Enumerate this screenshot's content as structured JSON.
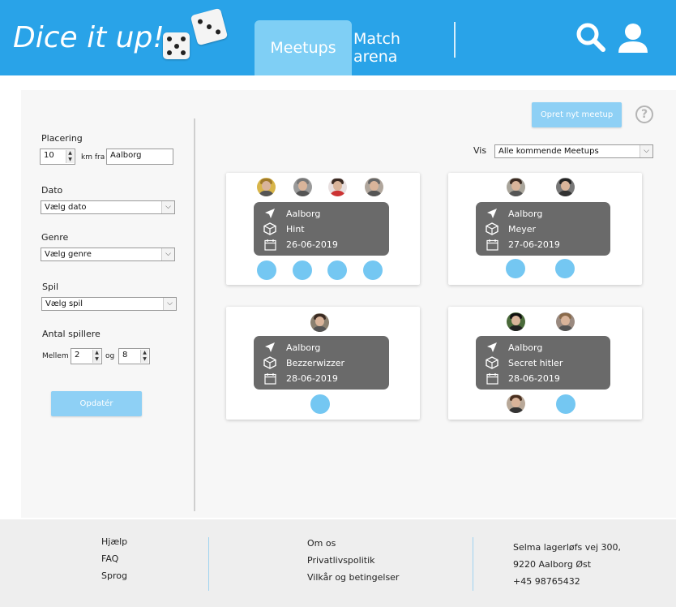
{
  "header": {
    "logo": "Dice it up!",
    "tabs": [
      {
        "label": "Meetups",
        "active": true
      },
      {
        "label": "Match arena",
        "active": false
      }
    ],
    "icons": [
      "search-icon",
      "user-icon"
    ],
    "colors": {
      "bar": "#29a3e8",
      "active_tab": "#7fcff5"
    }
  },
  "filters": {
    "location": {
      "label": "Placering",
      "distance": "10",
      "km_label": "km fra",
      "city": "Aalborg"
    },
    "date": {
      "label": "Dato",
      "value": "Vælg dato"
    },
    "genre": {
      "label": "Genre",
      "value": "Vælg genre"
    },
    "game": {
      "label": "Spil",
      "value": "Vælg spil"
    },
    "players": {
      "label": "Antal spillere",
      "between_label": "Mellem",
      "min": "2",
      "and_label": "og",
      "max": "8"
    },
    "update_button": "Opdatér"
  },
  "toolbar": {
    "create_button": "Opret nyt meetup",
    "show_label": "Vis",
    "show_value": "Alle kommende Meetups"
  },
  "meetups": [
    {
      "city": "Aalborg",
      "game": "Hint",
      "date": "26-06-2019"
    },
    {
      "city": "Aalborg",
      "game": "Meyer",
      "date": "27-06-2019"
    },
    {
      "city": "Aalborg",
      "game": "Bezzerwizzer",
      "date": "28-06-2019"
    },
    {
      "city": "Aalborg",
      "game": "Secret hitler",
      "date": "28-06-2019"
    }
  ],
  "footer": {
    "col1": [
      "Hjælp",
      "FAQ",
      "Sprog"
    ],
    "col2": [
      "Om os",
      "Privatlivspolitik",
      "Vilkår og betingelser"
    ],
    "col3": [
      "Selma lagerløfs vej 300,",
      "9220 Aalborg Øst",
      "+45 98765432"
    ]
  }
}
